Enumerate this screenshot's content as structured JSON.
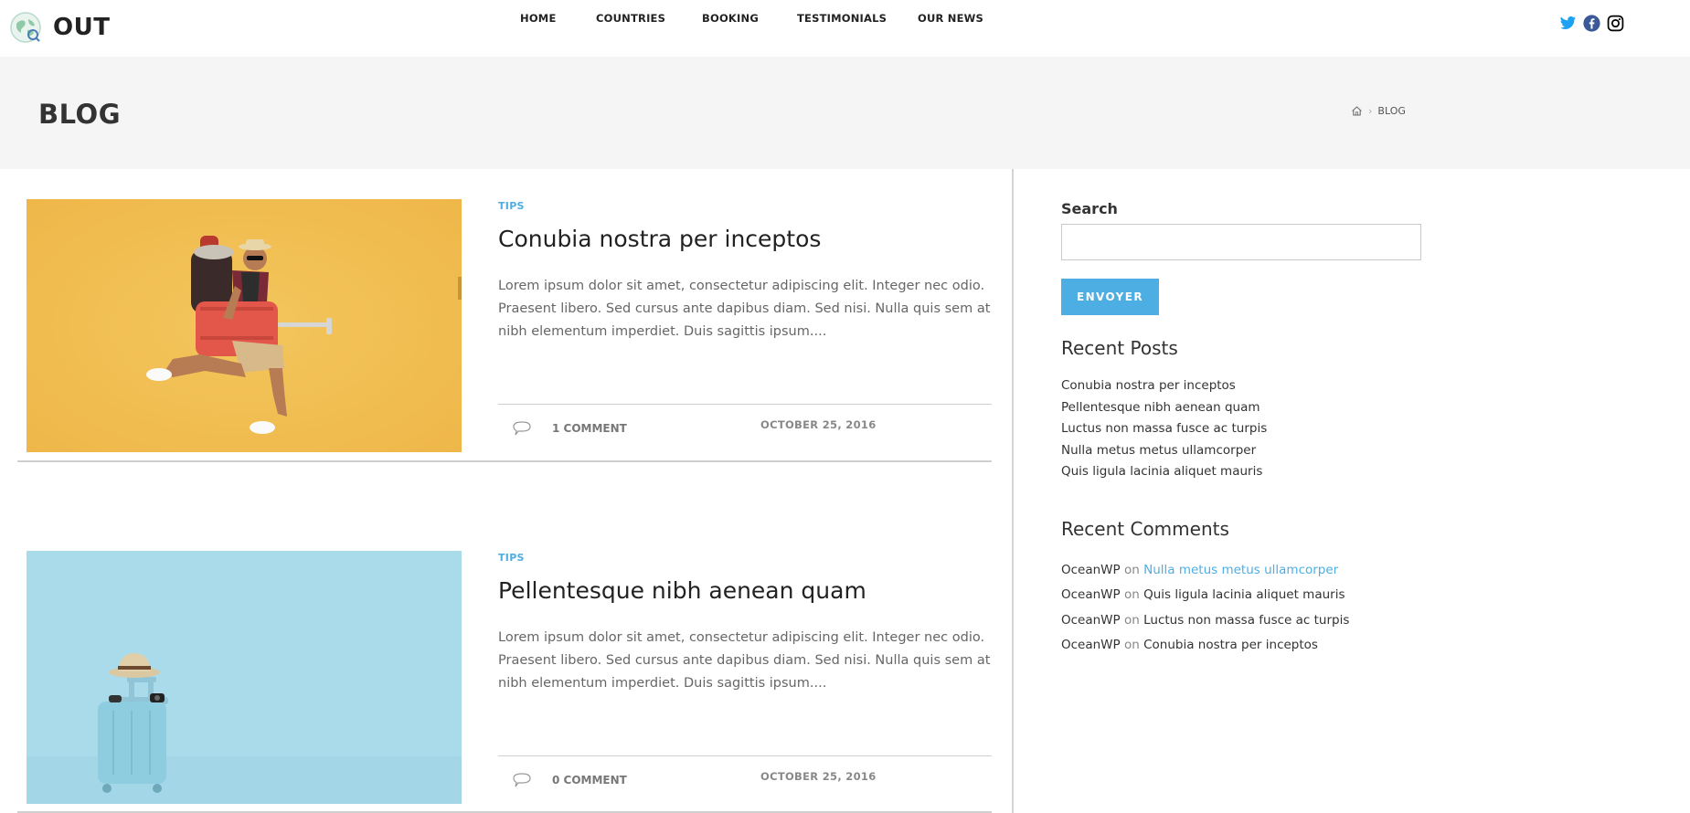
{
  "site": {
    "name": "OUT"
  },
  "nav": {
    "items": [
      {
        "label": "HOME"
      },
      {
        "label": "COUNTRIES"
      },
      {
        "label": "BOOKING"
      },
      {
        "label": "TESTIMONIALS"
      },
      {
        "label": "OUR NEWS"
      }
    ]
  },
  "social": {
    "icons": [
      "twitter-icon",
      "facebook-icon",
      "instagram-icon"
    ],
    "colors": {
      "twitter": "#1da1f2",
      "facebook": "#3b5998",
      "instagram": "#000000"
    }
  },
  "page_header": {
    "title": "BLOG",
    "breadcrumb": {
      "current": "BLOG"
    }
  },
  "accent_color": "#4daee4",
  "posts": [
    {
      "category": "TIPS",
      "title": "Conubia nostra per inceptos",
      "excerpt": "Lorem ipsum dolor sit amet, consectetur adipiscing elit. Integer nec odio. Praesent libero. Sed cursus ante dapibus diam. Sed nisi. Nulla quis sem at nibh elementum imperdiet. Duis sagittis ipsum....",
      "comments": "1 COMMENT",
      "date": "OCTOBER 25, 2016"
    },
    {
      "category": "TIPS",
      "title": "Pellentesque nibh aenean quam",
      "excerpt": "Lorem ipsum dolor sit amet, consectetur adipiscing elit. Integer nec odio. Praesent libero. Sed cursus ante dapibus diam. Sed nisi. Nulla quis sem at nibh elementum imperdiet. Duis sagittis ipsum....",
      "comments": "0 COMMENT",
      "date": "OCTOBER 25, 2016"
    }
  ],
  "sidebar": {
    "search": {
      "label": "Search",
      "value": "",
      "button": "ENVOYER"
    },
    "recent_posts": {
      "title": "Recent Posts",
      "items": [
        "Conubia nostra per inceptos",
        "Pellentesque nibh aenean quam",
        "Luctus non massa fusce ac turpis",
        "Nulla metus metus ullamcorper",
        "Quis ligula lacinia aliquet mauris"
      ]
    },
    "recent_comments": {
      "title": "Recent Comments",
      "items": [
        {
          "author": "OceanWP",
          "on": "on",
          "post": "Nulla metus metus ullamcorper"
        },
        {
          "author": "OceanWP",
          "on": "on",
          "post": "Quis ligula lacinia aliquet mauris"
        },
        {
          "author": "OceanWP",
          "on": "on",
          "post": "Luctus non massa fusce ac turpis"
        },
        {
          "author": "OceanWP",
          "on": "on",
          "post": "Conubia nostra per inceptos"
        }
      ]
    }
  }
}
